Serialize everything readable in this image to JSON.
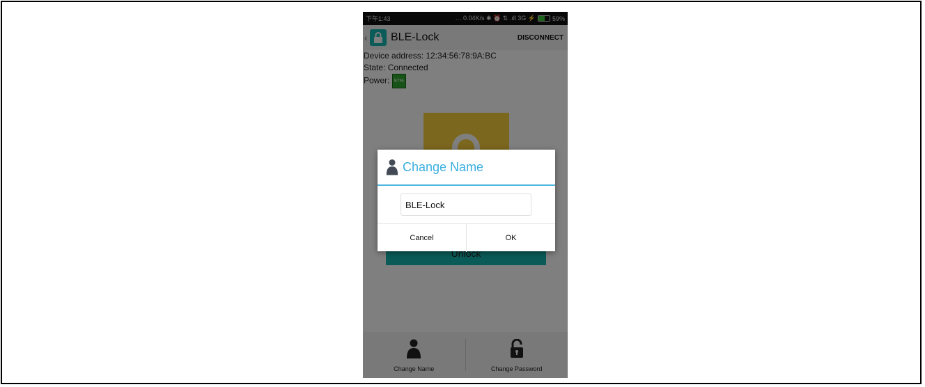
{
  "statusbar": {
    "time": "下午1:43",
    "indicators": "… 0.04K/s ✱ ⏰ ⇅ .ıll 3G ⚡",
    "battery_percent": "59%",
    "battery_level": 0.59
  },
  "appbar": {
    "back_icon": "chevron-left-icon",
    "app_icon": "lock-icon",
    "title": "BLE-Lock",
    "disconnect_label": "DISCONNECT"
  },
  "info": {
    "device_address": "Device address: 12:34:56:78:9A:BC",
    "state": "State: Connected",
    "power_label": "Power:",
    "power_value": "97%"
  },
  "main": {
    "unlock_label": "Unlock"
  },
  "dialog": {
    "icon": "user-icon",
    "title": "Change Name",
    "input_value": "BLE-Lock",
    "cancel_label": "Cancel",
    "ok_label": "OK"
  },
  "bottom_nav": {
    "change_name_label": "Change Name",
    "change_password_label": "Change Password"
  },
  "colors": {
    "accent_teal": "#14b7b1",
    "dialog_title_blue": "#39aee0",
    "lock_tile_yellow": "#f6cf3c"
  }
}
